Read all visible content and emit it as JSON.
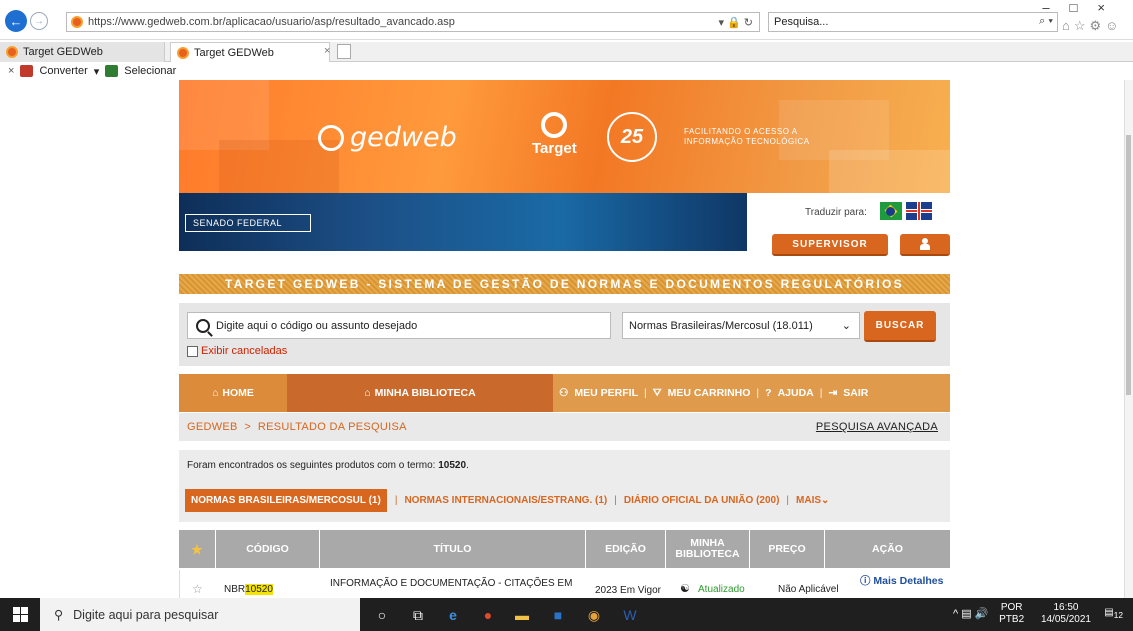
{
  "browser": {
    "url": "https://www.gedweb.com.br/aplicacao/usuario/asp/resultado_avancado.asp",
    "search_placeholder": "Pesquisa...",
    "tabs": [
      {
        "label": "Target GEDWeb"
      },
      {
        "label": "Target GEDWeb"
      }
    ],
    "commands": {
      "convert": "Converter",
      "select": "Selecionar"
    }
  },
  "banner": {
    "brand": "gedweb",
    "target": "Target",
    "anniversary": "25",
    "tagline_line1": "FACILITANDO O ACESSO A",
    "tagline_line2": "INFORMAÇÃO TECNOLÓGICA",
    "client": "SENADO FEDERAL"
  },
  "header": {
    "translate_label": "Traduzir para:",
    "supervisor_label": "SUPERVISOR",
    "system_title": "TARGET GEDWEB - SISTEMA DE GESTÃO DE NORMAS E DOCUMENTOS REGULATÓRIOS"
  },
  "search": {
    "placeholder": "Digite aqui o código ou assunto desejado",
    "collection": "Normas Brasileiras/Mercosul (18.011)",
    "button": "BUSCAR",
    "show_cancelled": "Exibir canceladas"
  },
  "nav": {
    "home": "HOME",
    "library": "MINHA BIBLIOTECA",
    "profile": "MEU PERFIL",
    "cart": "MEU CARRINHO",
    "help": "AJUDA",
    "logout": "SAIR"
  },
  "breadcrumb": {
    "root": "GEDWEB",
    "current": "RESULTADO DA PESQUISA",
    "advanced": "PESQUISA AVANÇADA"
  },
  "results": {
    "found_prefix": "Foram encontrados os seguintes produtos com o termo: ",
    "term": "10520",
    "tabs": {
      "br": "NORMAS BRASILEIRAS/MERCOSUL (1)",
      "intl": "NORMAS INTERNACIONAIS/ESTRANG. (1)",
      "dou": "DIÁRIO OFICIAL DA UNIÃO (200)",
      "more": "MAIS"
    }
  },
  "table": {
    "headers": {
      "code": "CÓDIGO",
      "title": "TÍTULO",
      "edition": "EDIÇÃO",
      "library": "MINHA BIBLIOTECA",
      "price": "PREÇO",
      "action": "AÇÃO"
    },
    "rows": [
      {
        "code_prefix": "NBR",
        "code_highlight": "10520",
        "title": "INFORMAÇÃO E DOCUMENTAÇÃO - CITAÇÕES EM",
        "edition": "2023 Em Vigor",
        "library": "Atualizado",
        "price": "Não Aplicável",
        "action": "Mais Detalhes"
      }
    ]
  },
  "taskbar": {
    "search_placeholder": "Digite aqui para pesquisar",
    "lang": "POR",
    "layout": "PTB2",
    "time": "16:50",
    "date": "14/05/2021",
    "notifications": "12"
  },
  "colors": {
    "accent": "#d8661e",
    "banner": "#f37824",
    "table_header": "#a9a9a9"
  }
}
